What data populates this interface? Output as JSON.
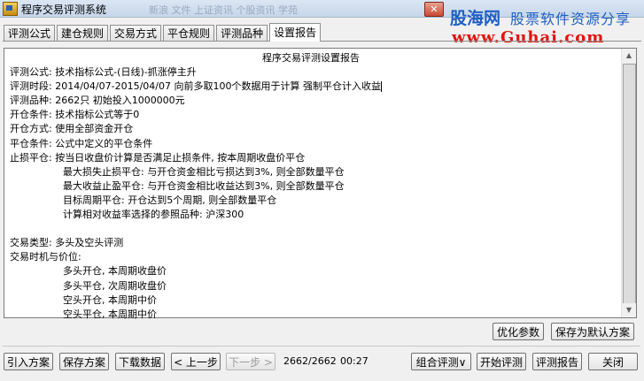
{
  "window": {
    "title": "程序交易评测系统",
    "ghost_menu": "新浪 文件 上证资讯 个股资讯 学苑",
    "close_label": "✕"
  },
  "watermark": {
    "brand": "股海网",
    "slogan": "股票软件资源分享",
    "url": "www.Guhai.com"
  },
  "tabs": [
    "评测公式",
    "建仓规则",
    "交易方式",
    "平仓规则",
    "评测品种",
    "设置报告"
  ],
  "report": {
    "title": "程序交易评测设置报告",
    "lines": [
      {
        "text": "评测公式: 技术指标公式-(日线)-抓涨停主升",
        "indent": false
      },
      {
        "text": "评测时段: 2014/04/07-2015/04/07 向前多取100个数据用于计算 强制平仓计入收益",
        "indent": false
      },
      {
        "text": "评测品种: 2662只 初始投入1000000元",
        "indent": false
      },
      {
        "text": "开仓条件: 技术指标公式等于0",
        "indent": false
      },
      {
        "text": "开仓方式: 使用全部资金开仓",
        "indent": false
      },
      {
        "text": "平仓条件: 公式中定义的平仓条件",
        "indent": false
      },
      {
        "text": "止损平仓: 按当日收盘价计算是否满足止损条件, 按本周期收盘价平仓",
        "indent": false
      },
      {
        "text": "最大损失止损平仓: 与开仓资金相比亏损达到3%, 则全部数量平仓",
        "indent": true
      },
      {
        "text": "最大收益止盈平仓: 与开仓资金相比收益达到3%, 则全部数量平仓",
        "indent": true
      },
      {
        "text": "目标周期平仓: 开仓达到5个周期, 则全部数量平仓",
        "indent": true
      },
      {
        "text": "计算相对收益率选择的参照品种: 沪深300",
        "indent": true
      },
      {
        "text": "",
        "indent": false
      },
      {
        "text": "交易类型: 多头及空头评测",
        "indent": false
      },
      {
        "text": "交易时机与价位:",
        "indent": false
      },
      {
        "text": "多头开仓, 本周期收盘价",
        "indent": true
      },
      {
        "text": "多头平仓, 次周期收盘价",
        "indent": true
      },
      {
        "text": "空头开仓, 本周期中价",
        "indent": true
      },
      {
        "text": "空头平仓, 本周期中价",
        "indent": true
      }
    ]
  },
  "buttons": {
    "optimize": "优化参数",
    "save_default": "保存为默认方案",
    "import": "引入方案",
    "save": "保存方案",
    "download": "下载数据",
    "prev": "< 上一步",
    "next": "下一步 >",
    "combo": "组合评测∨",
    "start": "开始评测",
    "report": "评测报告",
    "close": "关闭"
  },
  "status": {
    "progress": "2662/2662",
    "time": "00:27"
  }
}
